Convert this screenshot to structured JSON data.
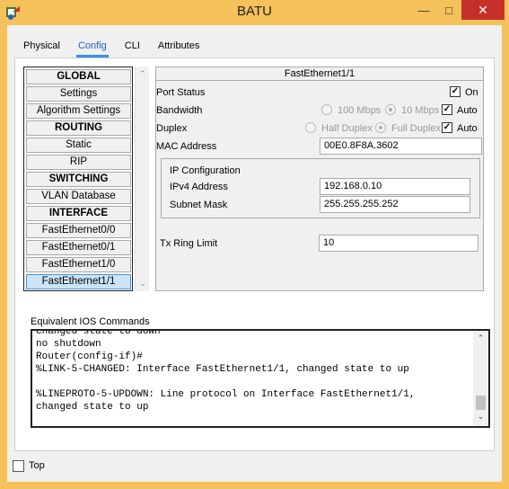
{
  "window": {
    "title": "BATU"
  },
  "tabs": [
    {
      "label": "Physical"
    },
    {
      "label": "Config",
      "active": true
    },
    {
      "label": "CLI"
    },
    {
      "label": "Attributes"
    }
  ],
  "sidebar": {
    "items": [
      {
        "label": "GLOBAL",
        "header": true
      },
      {
        "label": "Settings"
      },
      {
        "label": "Algorithm Settings"
      },
      {
        "label": "ROUTING",
        "header": true
      },
      {
        "label": "Static"
      },
      {
        "label": "RIP"
      },
      {
        "label": "SWITCHING",
        "header": true
      },
      {
        "label": "VLAN Database"
      },
      {
        "label": "INTERFACE",
        "header": true
      },
      {
        "label": "FastEthernet0/0"
      },
      {
        "label": "FastEthernet0/1"
      },
      {
        "label": "FastEthernet1/0"
      },
      {
        "label": "FastEthernet1/1",
        "selected": true
      }
    ]
  },
  "interface": {
    "title": "FastEthernet1/1",
    "port_status": {
      "label": "Port Status",
      "checkbox_label": "On",
      "checked": true
    },
    "bandwidth": {
      "label": "Bandwidth",
      "options": [
        "100 Mbps",
        "10 Mbps"
      ],
      "selected": "10 Mbps",
      "auto_label": "Auto",
      "auto_checked": true
    },
    "duplex": {
      "label": "Duplex",
      "options": [
        "Half Duplex",
        "Full Duplex"
      ],
      "selected": "Full Duplex",
      "auto_label": "Auto",
      "auto_checked": true
    },
    "mac": {
      "label": "MAC Address",
      "value": "00E0.8F8A.3602"
    },
    "ip_config": {
      "title": "IP Configuration",
      "ipv4_label": "IPv4 Address",
      "ipv4_value": "192.168.0.10",
      "mask_label": "Subnet Mask",
      "mask_value": "255.255.255.252"
    },
    "tx_ring": {
      "label": "Tx Ring Limit",
      "value": "10"
    }
  },
  "console": {
    "label": "Equivalent IOS Commands",
    "text": "changed state to down\nno shutdown\nRouter(config-if)#\n%LINK-5-CHANGED: Interface FastEthernet1/1, changed state to up\n\n%LINEPROTO-5-UPDOWN: Line protocol on Interface FastEthernet1/1,\nchanged state to up"
  },
  "footer": {
    "top_label": "Top",
    "top_checked": false
  },
  "colors": {
    "frame": "#f4c15a",
    "close": "#c7302a",
    "accent": "#3b8ee8"
  }
}
